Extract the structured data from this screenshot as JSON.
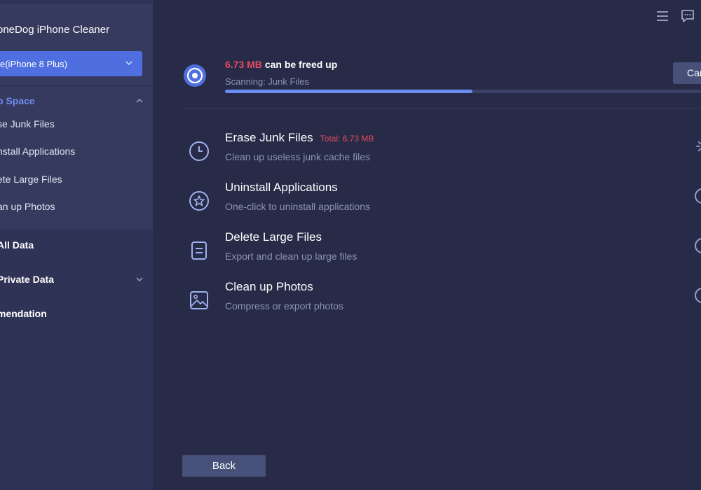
{
  "app": {
    "title": "oneDog iPhone Cleaner"
  },
  "device": {
    "selected": "e(iPhone 8 Plus)"
  },
  "sidebar": {
    "free_up_space": {
      "label": "p Space",
      "color": "#6e8cf0",
      "items": [
        {
          "label": "se Junk Files"
        },
        {
          "label": "nstall Applications"
        },
        {
          "label": "ete Large Files"
        },
        {
          "label": "an up Photos"
        }
      ]
    },
    "sections": [
      {
        "label": "All Data"
      },
      {
        "label": "Private Data"
      },
      {
        "label": "mendation"
      }
    ]
  },
  "top_icons": {
    "menu": "menu-icon",
    "feedback": "feedback-icon"
  },
  "scan": {
    "amount": "6.73 MB",
    "freed_suffix": "can be freed up",
    "status": "Scanning: Junk Files",
    "progress": 0.52,
    "cancel_label": "Car"
  },
  "features": [
    {
      "title": "Erase Junk Files",
      "total": "Total: 6.73 MB",
      "desc": "Clean up useless junk cache files",
      "icon": "clock-icon",
      "state": "scanning"
    },
    {
      "title": "Uninstall Applications",
      "desc": "One-click to uninstall applications",
      "icon": "app-store-icon",
      "state": "pending"
    },
    {
      "title": "Delete Large Files",
      "desc": "Export and clean up large files",
      "icon": "file-icon",
      "state": "pending"
    },
    {
      "title": "Clean up Photos",
      "desc": "Compress or export photos",
      "icon": "photo-icon",
      "state": "pending"
    }
  ],
  "footer": {
    "back_label": "Back"
  },
  "colors": {
    "accent": "#4f6fe0",
    "alert": "#e84a5f",
    "background": "#272b48",
    "sidebar": "#2f3355"
  }
}
